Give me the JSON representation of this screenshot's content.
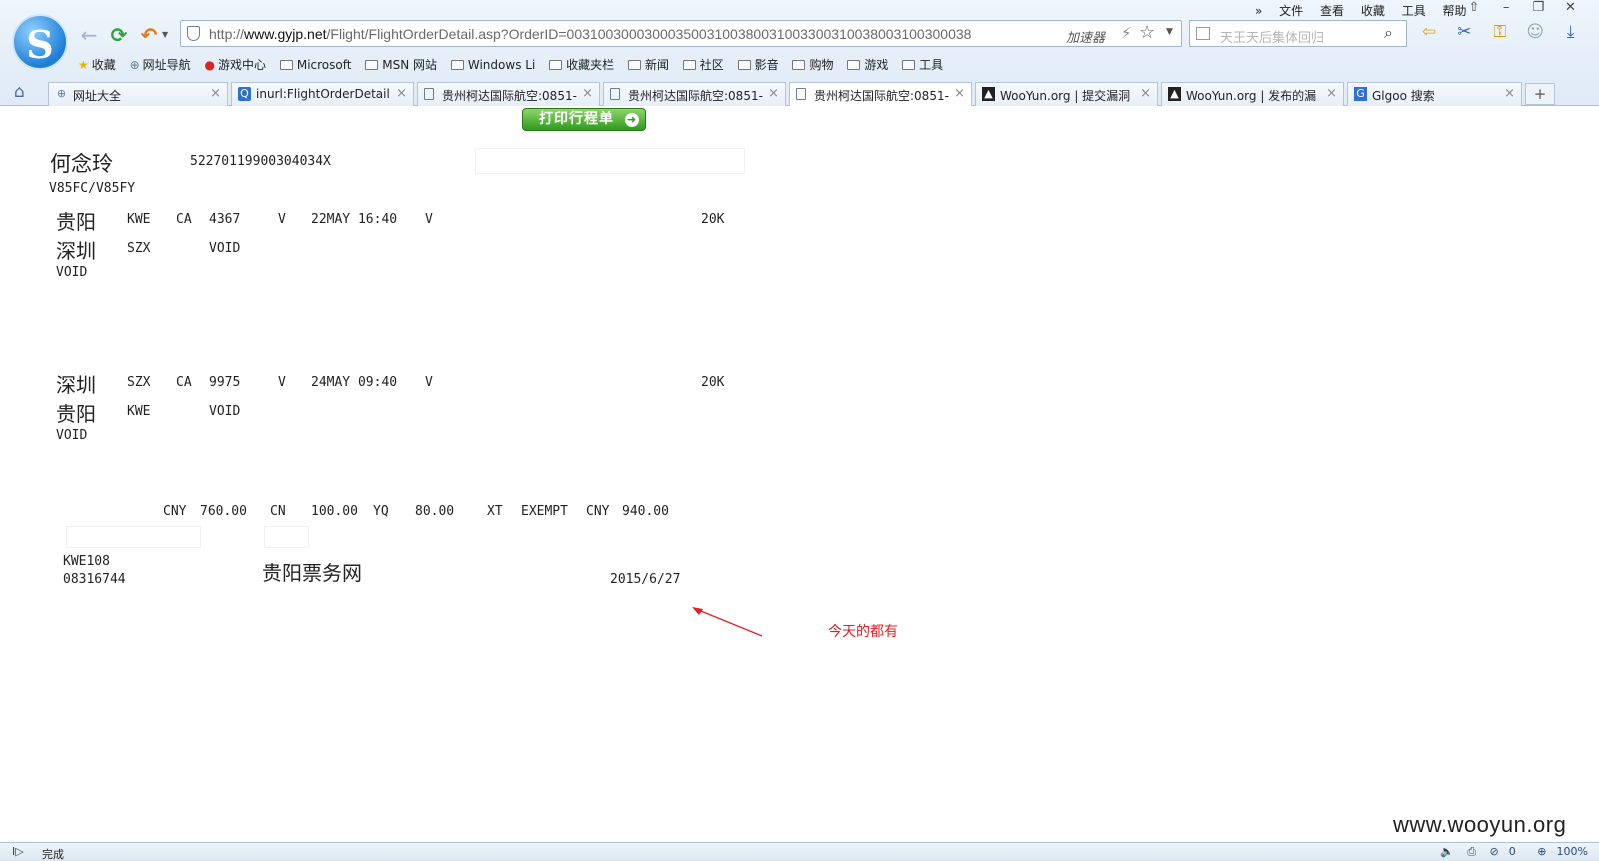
{
  "browser": {
    "logo_letter": "S",
    "url_prefix": "http://",
    "url_host": "www.gyjp.net",
    "url_path": "/Flight/FlightOrderDetail.asp?OrderID=0031003000300035003100380031003300310038003100300038",
    "accelerator_label": "加速器",
    "search_placeholder": "天王天后集体回归",
    "menu": [
      "文件",
      "查看",
      "收藏",
      "工具",
      "帮助"
    ],
    "favorites": [
      {
        "label": "收藏",
        "icon": "star-icon"
      },
      {
        "label": "网址导航",
        "icon": "globe-icon"
      },
      {
        "label": "游戏中心",
        "icon": "game-icon"
      },
      {
        "label": "Microsoft",
        "icon": "folder-icon"
      },
      {
        "label": "MSN 网站",
        "icon": "folder-icon"
      },
      {
        "label": "Windows Li",
        "icon": "folder-icon"
      },
      {
        "label": "收藏夹栏",
        "icon": "folder-icon"
      },
      {
        "label": "新闻",
        "icon": "folder-icon"
      },
      {
        "label": "社区",
        "icon": "folder-icon"
      },
      {
        "label": "影音",
        "icon": "folder-icon"
      },
      {
        "label": "购物",
        "icon": "folder-icon"
      },
      {
        "label": "游戏",
        "icon": "folder-icon"
      },
      {
        "label": "工具",
        "icon": "folder-icon"
      }
    ],
    "tabs": [
      {
        "label": "网址大全",
        "icon": "globe-icon"
      },
      {
        "label": "inurl:FlightOrderDetail.",
        "icon": "search-icon"
      },
      {
        "label": "贵州柯达国际航空:0851-",
        "icon": "page-icon"
      },
      {
        "label": "贵州柯达国际航空:0851-",
        "icon": "page-icon"
      },
      {
        "label": "贵州柯达国际航空:0851-",
        "icon": "page-icon",
        "active": true
      },
      {
        "label": "WooYun.org | 提交漏洞",
        "icon": "wooyun-icon"
      },
      {
        "label": "WooYun.org | 发布的漏",
        "icon": "wooyun-icon"
      },
      {
        "label": "Glgoo 搜索",
        "icon": "glgoo-icon"
      }
    ],
    "status_text": "完成",
    "status_counter": "0",
    "zoom": "100%"
  },
  "page": {
    "print_button": "打印行程单",
    "passenger_name": "何念玲",
    "id_number": "52270119900304034X",
    "fare_basis": "V85FC/V85FY",
    "segments": [
      {
        "from_city": "贵阳",
        "from_code": "KWE",
        "airline": "CA",
        "flight_no": "4367",
        "class": "V",
        "date_time": "22MAY 16:40",
        "class_suffix": "V",
        "baggage": "20K",
        "to_city": "深圳",
        "to_code": "SZX",
        "to_status": "VOID",
        "extra": "VOID"
      },
      {
        "from_city": "深圳",
        "from_code": "SZX",
        "airline": "CA",
        "flight_no": "9975",
        "class": "V",
        "date_time": "24MAY 09:40",
        "class_suffix": "V",
        "baggage": "20K",
        "to_city": "贵阳",
        "to_code": "KWE",
        "to_status": "VOID",
        "extra": "VOID"
      }
    ],
    "fare": {
      "cny_label": "CNY",
      "base_fare": "760.00",
      "cn_label": "CN",
      "cn_amount": "100.00",
      "yq_label": "YQ",
      "yq_amount": "80.00",
      "xt_label": "XT",
      "exempt_label": "EXEMPT",
      "total_label": "CNY",
      "total": "940.00"
    },
    "agent_code": "KWE108",
    "agent_number": "08316744",
    "agency_name": "贵阳票务网",
    "issue_date": "2015/6/27",
    "annotation": "今天的都有",
    "watermark": "www.wooyun.org"
  },
  "colors": {
    "annotation": "#e0201e",
    "print_button": "#2f9a1e"
  }
}
